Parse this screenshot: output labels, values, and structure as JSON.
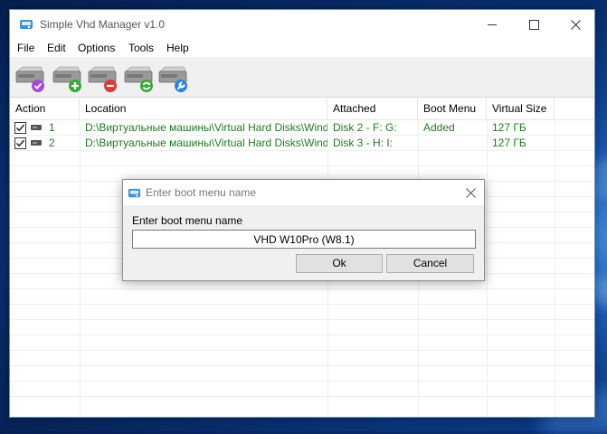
{
  "window": {
    "title": "Simple Vhd Manager v1.0"
  },
  "menu": [
    "File",
    "Edit",
    "Options",
    "Tools",
    "Help"
  ],
  "toolbar": {
    "buttons": [
      {
        "name": "attach-vhd",
        "icon": "disk-check-icon",
        "badge_color": "#a64ad8"
      },
      {
        "name": "add-vhd",
        "icon": "disk-add-icon",
        "badge_color": "#3aa83a"
      },
      {
        "name": "remove-vhd",
        "icon": "disk-remove-icon",
        "badge_color": "#d63a3a"
      },
      {
        "name": "refresh-vhd",
        "icon": "disk-refresh-icon",
        "badge_color": "#3aa83a"
      },
      {
        "name": "tools-vhd",
        "icon": "disk-wrench-icon",
        "badge_color": "#2f82d8"
      }
    ]
  },
  "table": {
    "columns": [
      "Action",
      "Location",
      "Attached",
      "Boot Menu",
      "Virtual Size"
    ],
    "rows": [
      {
        "num": "1",
        "location": "D:\\Виртуальные машины\\Virtual Hard Disks\\Windo...",
        "attached": "Disk 2  -  F: G:",
        "boot_menu": "Added",
        "size": "127 ГБ",
        "checked": true
      },
      {
        "num": "2",
        "location": "D:\\Виртуальные машины\\Virtual Hard Disks\\Windo...",
        "attached": "Disk 3  -  H: I:",
        "boot_menu": "",
        "size": "127 ГБ",
        "checked": true
      }
    ]
  },
  "dialog": {
    "title": "Enter boot menu name",
    "label": "Enter boot menu name",
    "input_value": "VHD W10Pro (W8.1)",
    "ok_label": "Ok",
    "cancel_label": "Cancel"
  },
  "colors": {
    "row_text": "#1f7a1f",
    "accent": "#2f82d8"
  }
}
